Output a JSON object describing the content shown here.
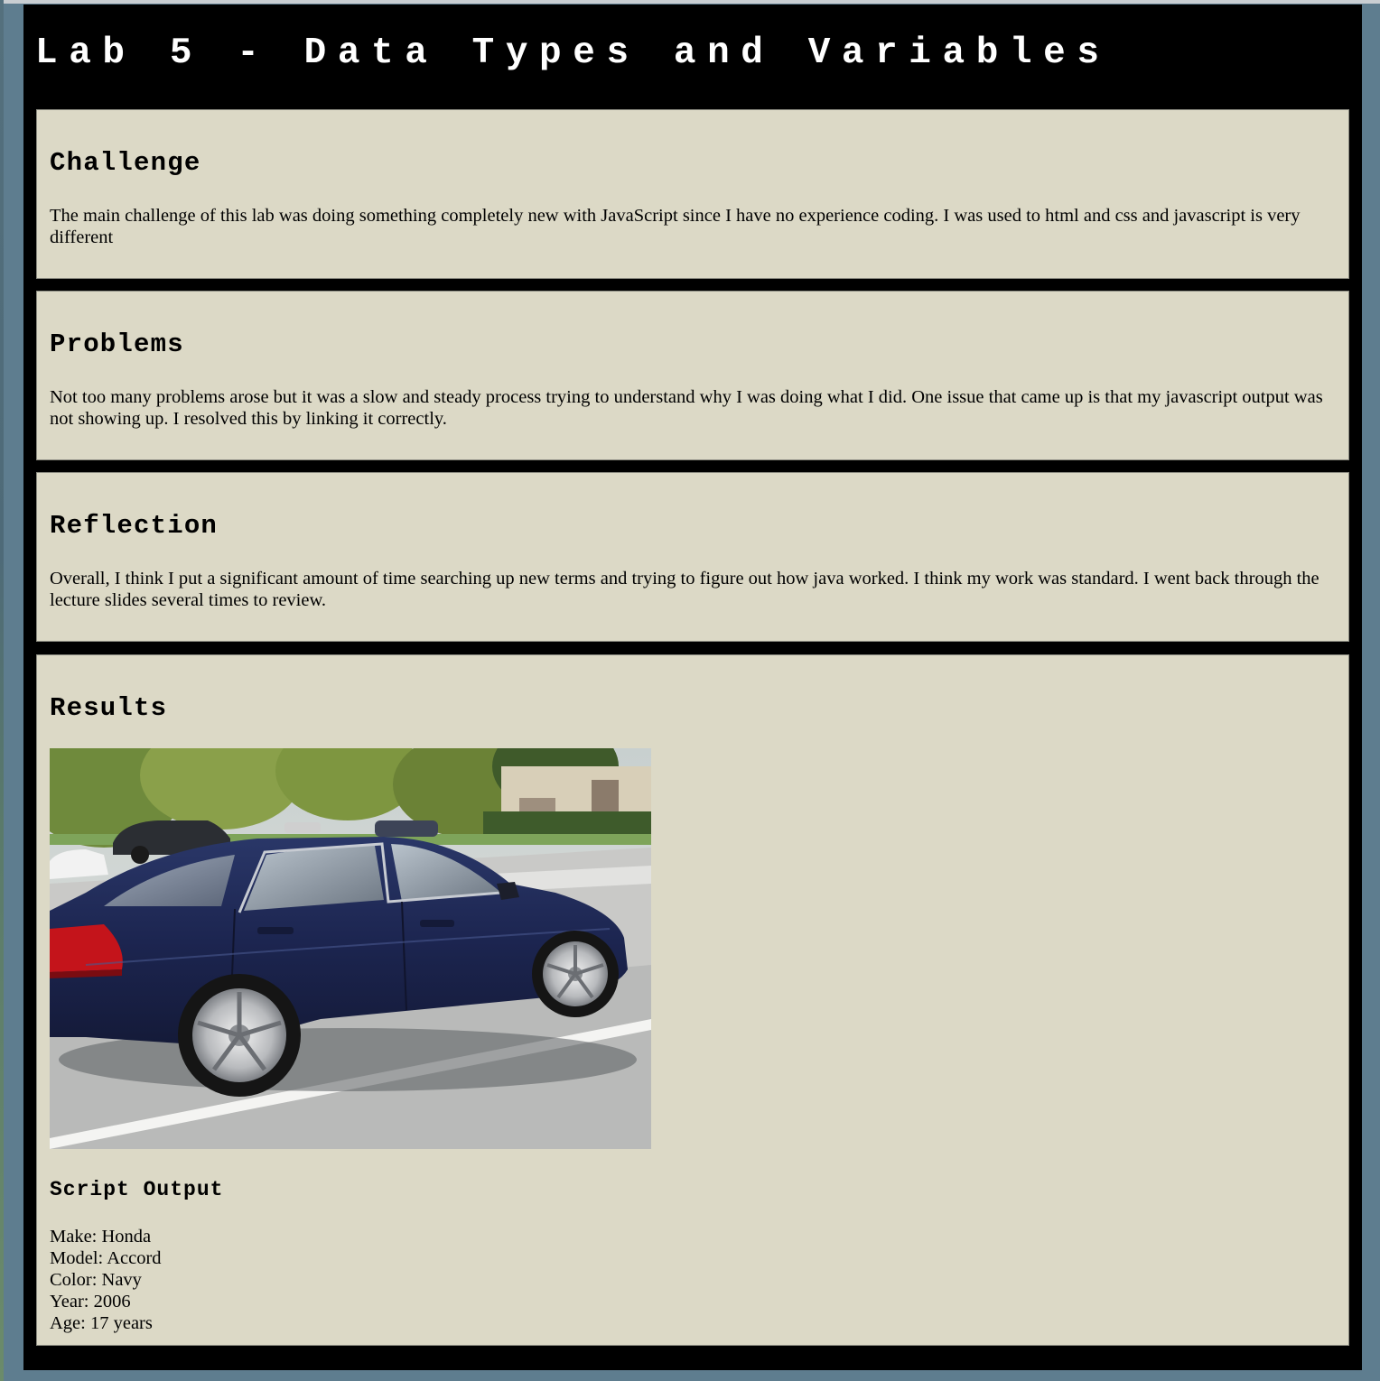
{
  "page": {
    "title": "Lab 5 - Data Types and Variables"
  },
  "sections": {
    "challenge": {
      "heading": "Challenge",
      "body": "The main challenge of this lab was doing something completely new with JavaScript since I have no experience coding. I was used to html and css and javascript is very different"
    },
    "problems": {
      "heading": "Problems",
      "body": "Not too many problems arose but it was a slow and steady process trying to understand why I was doing what I did. One issue that came up is that my javascript output was not showing up. I resolved this by linking it correctly."
    },
    "reflection": {
      "heading": "Reflection",
      "body": "Overall, I think I put a significant amount of time searching up new terms and trying to figure out how java worked. I think my work was standard. I went back through the lecture slides several times to review."
    },
    "results": {
      "heading": "Results",
      "script_heading": "Script Output",
      "output": {
        "make": "Make: Honda",
        "model": "Model: Accord",
        "color": "Color: Navy",
        "year": "Year: 2006",
        "age": "Age: 17 years"
      }
    }
  },
  "colors": {
    "page_bg": "#000000",
    "section_bg": "#dcd9c6",
    "outer_bg": "#5e7d8f",
    "car_body": "#1f2a52"
  }
}
